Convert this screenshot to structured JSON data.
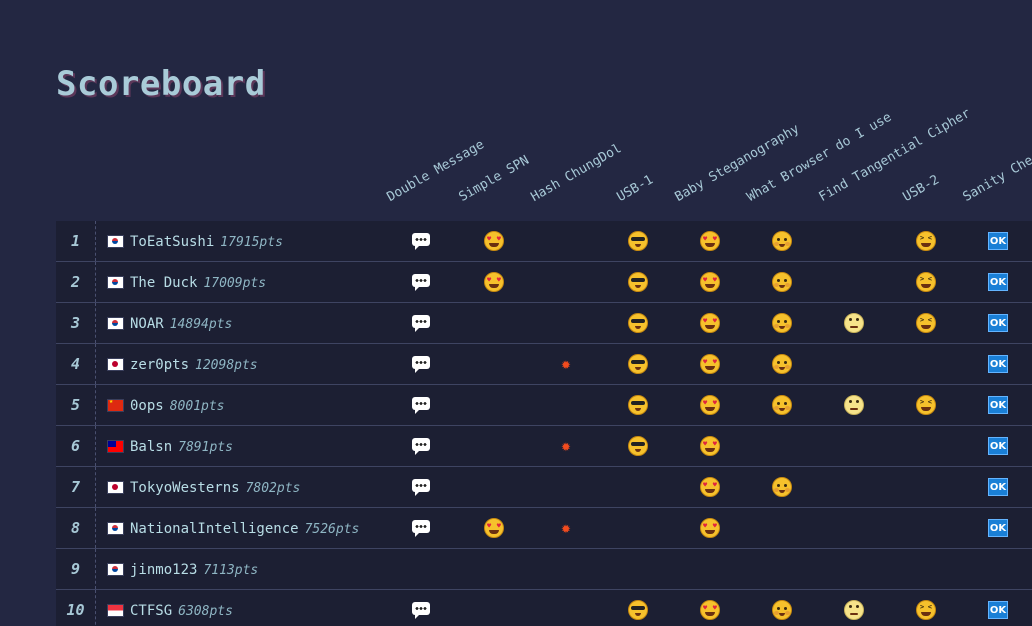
{
  "page": {
    "title": "Scoreboard"
  },
  "challenges": [
    "Double Message",
    "Simple SPN",
    "Hash ChungDol",
    "USB-1",
    "Baby Steganography",
    "What Browser do I use",
    "Find Tangential Cipher",
    "USB-2",
    "Sanity Che"
  ],
  "badge_icons": {
    "Double Message": "speech-bubble-icon",
    "Simple SPN": "star-struck-face-icon",
    "Hash ChungDol": "collision-icon",
    "USB-1": "sunglasses-face-icon",
    "Baby Steganography": "heart-eyes-face-icon",
    "What Browser do I use": "hugging-face-icon",
    "Find Tangential Cipher": "rolling-eyes-face-icon",
    "USB-2": "tired-face-icon",
    "Sanity Che": "ok-button-icon"
  },
  "colors": {
    "background": "#232742",
    "row_background": "#1c1f33",
    "text": "#a7c8d6",
    "ok_badge": "#1a7fd6"
  },
  "teams": [
    {
      "rank": "1",
      "flag": "kr",
      "name": "ToEatSushi",
      "points": "17915pts",
      "solved": [
        1,
        1,
        0,
        1,
        1,
        1,
        0,
        1,
        1
      ]
    },
    {
      "rank": "2",
      "flag": "kr",
      "name": "The Duck",
      "points": "17009pts",
      "solved": [
        1,
        1,
        0,
        1,
        1,
        1,
        0,
        1,
        1
      ]
    },
    {
      "rank": "3",
      "flag": "kr",
      "name": "NOAR",
      "points": "14894pts",
      "solved": [
        1,
        0,
        0,
        1,
        1,
        1,
        1,
        1,
        1
      ]
    },
    {
      "rank": "4",
      "flag": "jp",
      "name": "zer0pts",
      "points": "12098pts",
      "solved": [
        1,
        0,
        1,
        1,
        1,
        1,
        0,
        0,
        1
      ]
    },
    {
      "rank": "5",
      "flag": "cn",
      "name": "0ops",
      "points": "8001pts",
      "solved": [
        1,
        0,
        0,
        1,
        1,
        1,
        1,
        1,
        1
      ]
    },
    {
      "rank": "6",
      "flag": "tw",
      "name": "Balsn",
      "points": "7891pts",
      "solved": [
        1,
        0,
        1,
        1,
        1,
        0,
        0,
        0,
        1
      ]
    },
    {
      "rank": "7",
      "flag": "jp",
      "name": "TokyoWesterns",
      "points": "7802pts",
      "solved": [
        1,
        0,
        0,
        0,
        1,
        1,
        0,
        0,
        1
      ]
    },
    {
      "rank": "8",
      "flag": "kr",
      "name": "NationalIntelligence",
      "points": "7526pts",
      "solved": [
        1,
        1,
        1,
        0,
        1,
        0,
        0,
        0,
        1
      ]
    },
    {
      "rank": "9",
      "flag": "kr",
      "name": "jinmo123",
      "points": "7113pts",
      "solved": [
        0,
        0,
        0,
        0,
        0,
        0,
        0,
        0,
        0
      ]
    },
    {
      "rank": "10",
      "flag": "sg",
      "name": "CTFSG",
      "points": "6308pts",
      "solved": [
        1,
        0,
        0,
        1,
        1,
        1,
        1,
        1,
        1
      ]
    }
  ],
  "ok_label": "OK"
}
